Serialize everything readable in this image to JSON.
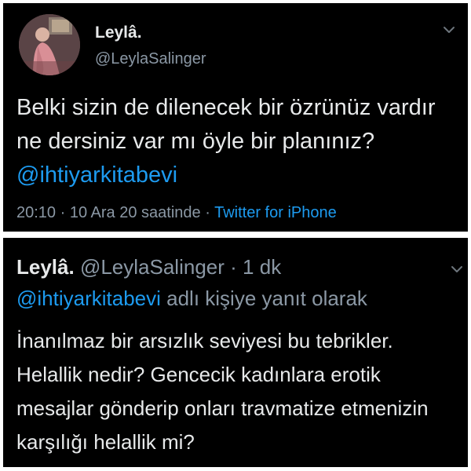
{
  "tweet": {
    "display_name": "Leylâ.",
    "handle": "@LeylaSalinger",
    "text": "Belki sizin de dilenecek bir özrünüz vardır ne dersiniz var mı öyle bir planınız?",
    "mention": "@ihtiyarkitabevi",
    "time": "20:10",
    "date": "10 Ara 20 saatinde",
    "separator": "·",
    "source": "Twitter for iPhone"
  },
  "reply": {
    "display_name": "Leylâ.",
    "handle": "@LeylaSalinger",
    "separator": "·",
    "age": "1 dk",
    "reply_to_mention": "@ihtiyarkitabevi",
    "reply_to_suffix": "adlı kişiye yanıt olarak",
    "text": "İnanılmaz bir arsızlık seviyesi bu tebrikler. Helallik nedir? Gencecik kadınlara erotik mesajlar gönderip onları travmatize etmenizin karşılığı helallik mi?"
  },
  "icons": {
    "more": "chevron-down-icon",
    "avatar": "profile-photo"
  },
  "colors": {
    "background": "#000000",
    "text": "#e7e9ea",
    "secondary": "#8b98a5",
    "accent": "#1d9bf0"
  }
}
